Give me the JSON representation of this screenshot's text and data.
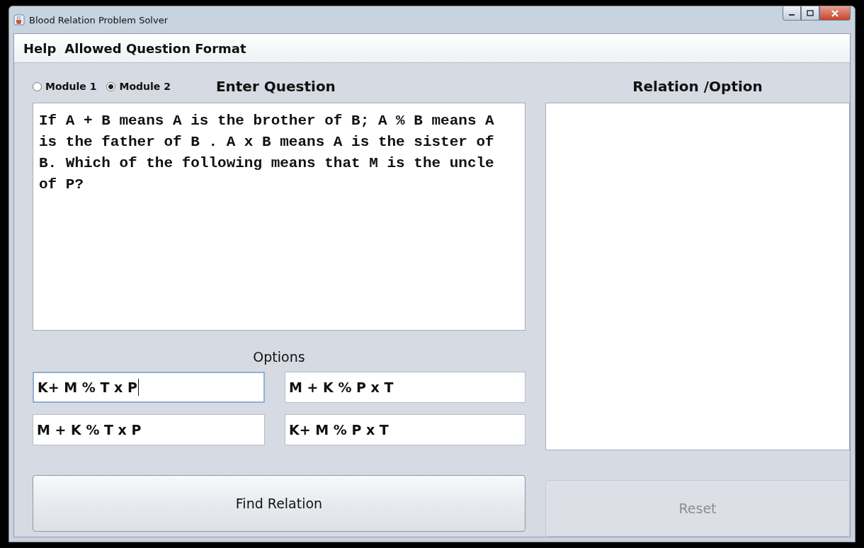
{
  "window": {
    "title": "Blood Relation Problem Solver"
  },
  "menu": [
    "Help",
    "Allowed Question Format"
  ],
  "modules": [
    {
      "label": "Module 1",
      "selected": false
    },
    {
      "label": "Module 2",
      "selected": true
    }
  ],
  "question": {
    "heading": "Enter Question",
    "value": "If A + B means A is the brother of B; A % B means A is the father of B . A x B means A is the sister of B. Which of the following means that M is the uncle of P?"
  },
  "options": {
    "heading": "Options",
    "fields": [
      {
        "value": "K+ M % T x P",
        "focused": true
      },
      {
        "value": "M + K % P x T",
        "focused": false
      },
      {
        "value": "M + K % T x P",
        "focused": false
      },
      {
        "value": "K+ M % P x T",
        "focused": false
      }
    ]
  },
  "result": {
    "heading": "Relation /Option"
  },
  "buttons": [
    {
      "label": "Find Relation",
      "disabled": false
    },
    {
      "label": "Reset",
      "disabled": true
    }
  ]
}
